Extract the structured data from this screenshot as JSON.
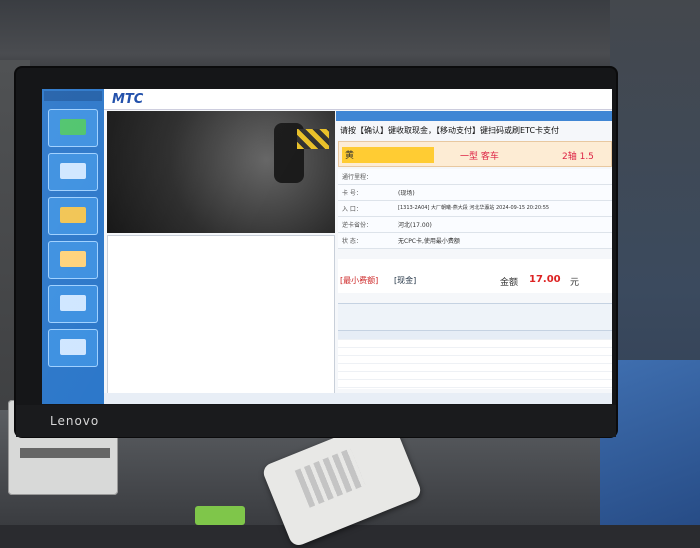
{
  "monitor": {
    "brand": "Lenovo"
  },
  "app": {
    "logo": "MTC",
    "prompt": "请按【确认】键收取现金，【移动支付】键扫码或刷ETC卡支付",
    "plate_prefix": "黄",
    "vehicle_class": "一型 客车",
    "axles": "2轴 1.5",
    "fields": [
      {
        "label": "通行里程：",
        "value": ""
      },
      {
        "label": "卡  号：",
        "value": "(现场)"
      },
      {
        "label": "入  口：",
        "value": "[1313-2A04] 大厂朝曦-燕大段 河北华瀛站 2024-09-15 20:20:55"
      },
      {
        "label": "逆卡省份：",
        "value": "河北(17.00)"
      },
      {
        "label": "状  态：",
        "value": "无CPC卡,使用最小费额"
      }
    ],
    "fee_type": "[最小费额]",
    "payment": "[现金]",
    "amount_label": "金额",
    "amount": "17.00",
    "unit": "元"
  },
  "colors": {
    "accent": "#2a76c9",
    "warning": "#d22",
    "plate": "#ffcc33"
  },
  "icons": [
    "confirm-icon",
    "card-icon",
    "toll-icon",
    "bell-icon",
    "etc-icon",
    "money-icon"
  ]
}
